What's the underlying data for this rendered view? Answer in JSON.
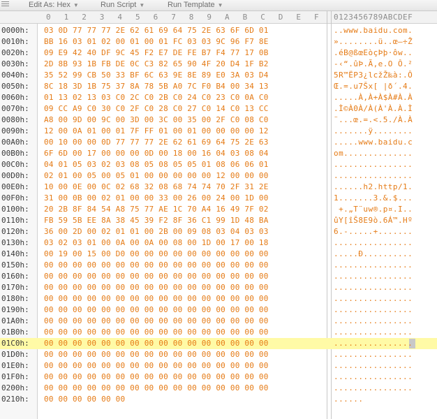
{
  "toolbar": {
    "edit_as": "Edit As: Hex",
    "run_script": "Run Script",
    "run_template": "Run Template"
  },
  "columns": {
    "hex": [
      "0",
      "1",
      "2",
      "3",
      "4",
      "5",
      "6",
      "7",
      "8",
      "9",
      "A",
      "B",
      "C",
      "D",
      "E",
      "F"
    ],
    "ascii": "0123456789ABCDEF"
  },
  "rows": [
    {
      "offset": "0000h:",
      "hex": "03 0D 77 77 77 2E 62 61 69 64 75 2E 63 6F 6D 01",
      "ascii": "..www.baidu.com."
    },
    {
      "offset": "0010h:",
      "hex": "BB 16 03 01 02 00 01 00 01 FC 03 03 9C 96 F7 8E",
      "ascii": "»........ü..œ–÷Ž"
    },
    {
      "offset": "0020h:",
      "hex": "09 E9 42 40 DF 9C 45 F2 E7 DE FE B7 F4 77 17 0B",
      "ascii": ".éB@ßœEòçÞþ·ôw.."
    },
    {
      "offset": "0030h:",
      "hex": "2D 8B 93 1B FB DE 0C C3 82 65 90 4F 20 D4 1F B2",
      "ascii": "-‹“.ûÞ.Ã‚e.O Ô.²"
    },
    {
      "offset": "0040h:",
      "hex": "35 52 99 CB 50 33 BF 6C 63 9E 8E 89 E0 3A 03 D4",
      "ascii": "5R™ËP3¿lcžŽ‰à:.Ô"
    },
    {
      "offset": "0050h:",
      "hex": "8C 18 3D 1B 75 37 8A 78 5B A0 7C F0 B4 00 34 13",
      "ascii": "Œ.=.u7Šx[ |ð´.4."
    },
    {
      "offset": "0060h:",
      "hex": "01 13 02 13 03 C0 2C C0 2B C0 24 C0 23 C0 0A C0",
      "ascii": ".....À,À+À$À#À.À"
    },
    {
      "offset": "0070h:",
      "hex": "09 CC A9 C0 30 C0 2F C0 28 C0 27 C0 14 C0 13 CC",
      "ascii": ".Ì©À0À/À(À'À.À.Ì"
    },
    {
      "offset": "0080h:",
      "hex": "A8 00 9D 00 9C 00 3D 00 3C 00 35 00 2F C0 08 C0",
      "ascii": "¨...œ.=.<.5./À.À"
    },
    {
      "offset": "0090h:",
      "hex": "12 00 0A 01 00 01 7F FF 01 00 01 00 00 00 00 12",
      "ascii": ".......ÿ........"
    },
    {
      "offset": "00A0h:",
      "hex": "00 10 00 00 0D 77 77 77 2E 62 61 69 64 75 2E 63",
      "ascii": ".....www.baidu.c"
    },
    {
      "offset": "00B0h:",
      "hex": "6F 6D 00 17 00 00 00 0D 00 18 00 16 04 03 08 04",
      "ascii": "om.............."
    },
    {
      "offset": "00C0h:",
      "hex": "04 01 05 03 02 03 08 05 08 05 05 01 08 06 06 01",
      "ascii": "................"
    },
    {
      "offset": "00D0h:",
      "hex": "02 01 00 05 00 05 01 00 00 00 00 00 12 00 00 00",
      "ascii": "................"
    },
    {
      "offset": "00E0h:",
      "hex": "10 00 0E 00 0C 02 68 32 08 68 74 74 70 2F 31 2E",
      "ascii": "......h2.http/1."
    },
    {
      "offset": "00F0h:",
      "hex": "31 00 0B 00 02 01 00 00 33 00 26 00 24 00 1D 00",
      "ascii": "1.......3.&.$..."
    },
    {
      "offset": "0100h:",
      "hex": "20 2B 8F 84 54 A8 75 77 AE 1C 70 A4 16 49 7F 02",
      "ascii": " +.„T¨uw®.p¤.I.."
    },
    {
      "offset": "0110h:",
      "hex": "FB 59 5B EE 8A 38 45 39 F2 8F 36 C1 99 1D 48 BA",
      "ascii": "ûY[îŠ8E9ò.6Á™.Hº"
    },
    {
      "offset": "0120h:",
      "hex": "36 00 2D 00 02 01 01 00 2B 00 09 08 03 04 03 03",
      "ascii": "6.-.....+......."
    },
    {
      "offset": "0130h:",
      "hex": "03 02 03 01 00 0A 00 0A 00 08 00 1D 00 17 00 18",
      "ascii": "................"
    },
    {
      "offset": "0140h:",
      "hex": "00 19 00 15 00 D0 00 00 00 00 00 00 00 00 00 00",
      "ascii": ".....Ð.........."
    },
    {
      "offset": "0150h:",
      "hex": "00 00 00 00 00 00 00 00 00 00 00 00 00 00 00 00",
      "ascii": "................"
    },
    {
      "offset": "0160h:",
      "hex": "00 00 00 00 00 00 00 00 00 00 00 00 00 00 00 00",
      "ascii": "................"
    },
    {
      "offset": "0170h:",
      "hex": "00 00 00 00 00 00 00 00 00 00 00 00 00 00 00 00",
      "ascii": "................"
    },
    {
      "offset": "0180h:",
      "hex": "00 00 00 00 00 00 00 00 00 00 00 00 00 00 00 00",
      "ascii": "................"
    },
    {
      "offset": "0190h:",
      "hex": "00 00 00 00 00 00 00 00 00 00 00 00 00 00 00 00",
      "ascii": "................"
    },
    {
      "offset": "01A0h:",
      "hex": "00 00 00 00 00 00 00 00 00 00 00 00 00 00 00 00",
      "ascii": "................"
    },
    {
      "offset": "01B0h:",
      "hex": "00 00 00 00 00 00 00 00 00 00 00 00 00 00 00 00",
      "ascii": "................"
    },
    {
      "offset": "01C0h:",
      "hex": "00 00 00 00 00 00 00 00 00 00 00 00 00 00 00 00",
      "ascii": "................",
      "highlight": true
    },
    {
      "offset": "01D0h:",
      "hex": "00 00 00 00 00 00 00 00 00 00 00 00 00 00 00 00",
      "ascii": "................"
    },
    {
      "offset": "01E0h:",
      "hex": "00 00 00 00 00 00 00 00 00 00 00 00 00 00 00 00",
      "ascii": "................"
    },
    {
      "offset": "01F0h:",
      "hex": "00 00 00 00 00 00 00 00 00 00 00 00 00 00 00 00",
      "ascii": "................"
    },
    {
      "offset": "0200h:",
      "hex": "00 00 00 00 00 00 00 00 00 00 00 00 00 00 00 00",
      "ascii": "................"
    },
    {
      "offset": "0210h:",
      "hex": "00 00 00 00 00 00",
      "ascii": "......"
    }
  ],
  "colors": {
    "bytes": "#e57b16",
    "highlight": "#fffaa6",
    "offset": "#3a3a3a"
  }
}
